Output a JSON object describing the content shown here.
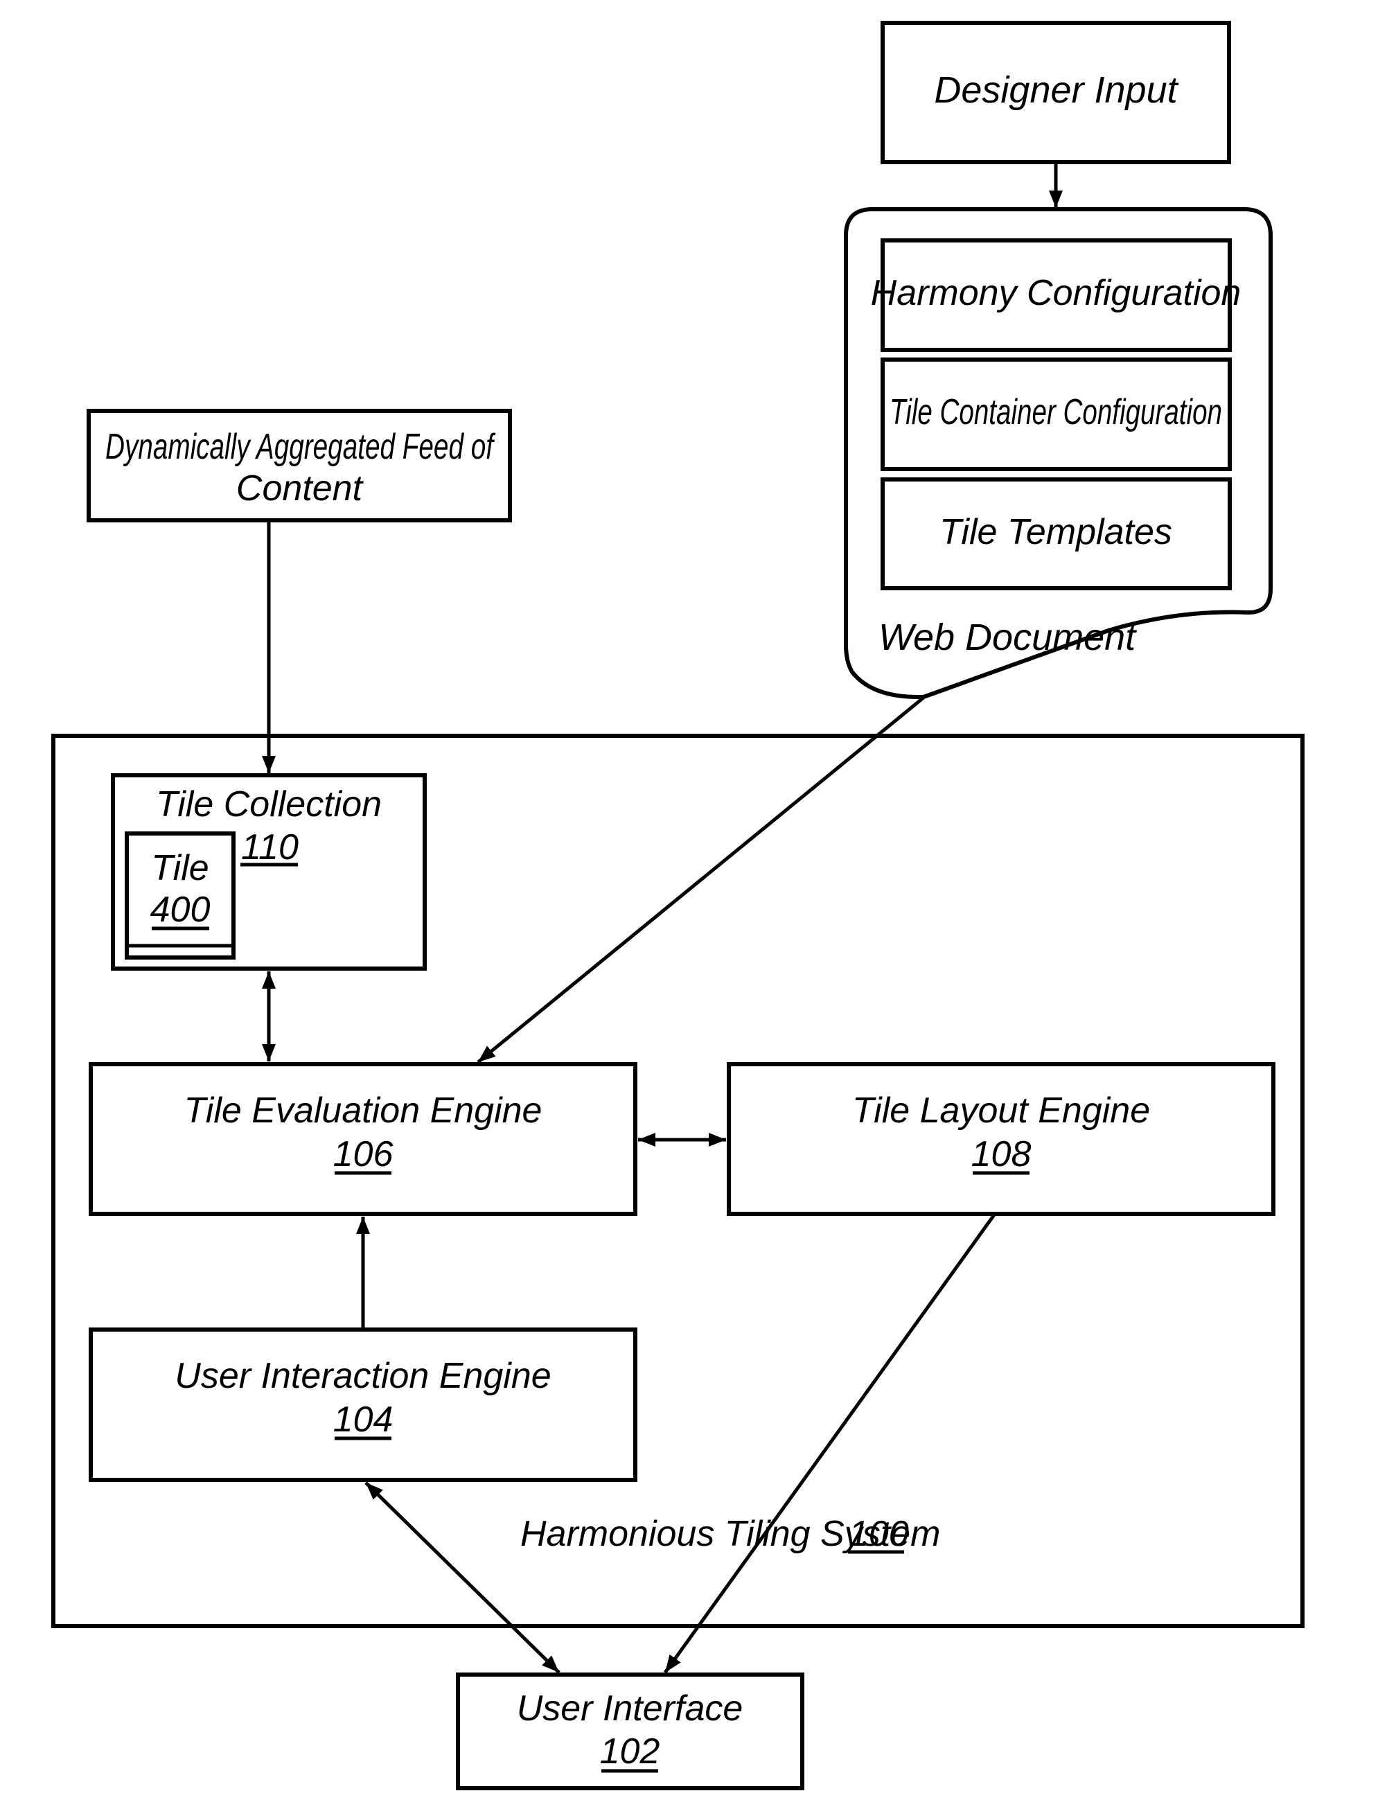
{
  "diagram": {
    "designer_input": {
      "label": "Designer Input"
    },
    "web_document": {
      "label": "Web Document",
      "sections": [
        {
          "label": "Harmony Configuration"
        },
        {
          "label": "Tile Container Configuration"
        },
        {
          "label": "Tile Templates"
        }
      ]
    },
    "feed": {
      "line1": "Dynamically Aggregated Feed of",
      "line2": "Content"
    },
    "system": {
      "label": "Harmonious Tiling System",
      "ref": "100"
    },
    "tile_collection": {
      "label": "Tile Collection",
      "ref": "110"
    },
    "tile": {
      "label": "Tile",
      "ref": "400"
    },
    "evaluation_engine": {
      "label": "Tile Evaluation Engine",
      "ref": "106"
    },
    "layout_engine": {
      "label": "Tile Layout Engine",
      "ref": "108"
    },
    "interaction_engine": {
      "label": "User Interaction Engine",
      "ref": "104"
    },
    "user_interface": {
      "label": "User Interface",
      "ref": "102"
    },
    "colors": {
      "stroke": "#000000",
      "background": "#ffffff"
    }
  }
}
